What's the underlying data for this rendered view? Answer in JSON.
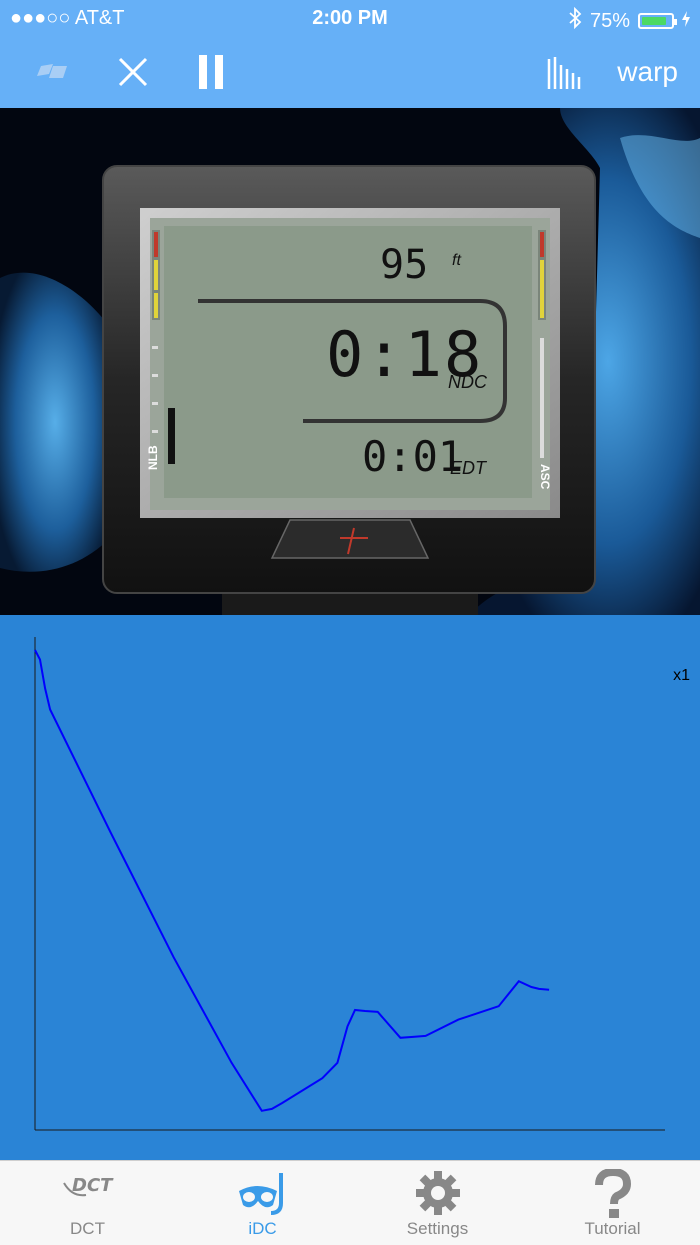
{
  "status_bar": {
    "carrier": "●●●○○ AT&T",
    "time": "2:00 PM",
    "battery": "75%"
  },
  "nav": {
    "warp_label": "warp"
  },
  "dive_computer": {
    "depth": "95",
    "depth_unit": "ft",
    "main_time": "0:18",
    "main_time_label": "NDC",
    "secondary_time": "0:01",
    "secondary_time_label": "EDT",
    "left_gauge_label": "NLB",
    "right_gauge_label": "ASC"
  },
  "graph": {
    "scale_label": "x1"
  },
  "chart_data": {
    "type": "line",
    "series": [
      {
        "values": [
          [
            0,
            0
          ],
          [
            2,
            -10
          ],
          [
            4,
            -40
          ],
          [
            6,
            -62
          ],
          [
            30,
            -190
          ],
          [
            55,
            -320
          ],
          [
            78,
            -430
          ],
          [
            90,
            -480
          ],
          [
            94,
            -478
          ],
          [
            98,
            -472
          ],
          [
            114,
            -446
          ],
          [
            120,
            -430
          ],
          [
            124,
            -392
          ],
          [
            127,
            -375
          ],
          [
            131,
            -376
          ],
          [
            136,
            -377
          ],
          [
            145,
            -404
          ],
          [
            150,
            -403
          ],
          [
            155,
            -402
          ],
          [
            168,
            -385
          ],
          [
            184,
            -371
          ],
          [
            192,
            -345
          ],
          [
            197,
            -351
          ],
          [
            200,
            -353
          ],
          [
            204,
            -354
          ]
        ]
      }
    ],
    "xlim": [
      0,
      250
    ],
    "ylim": [
      -500,
      0
    ],
    "grid": false
  },
  "tabs": [
    {
      "label": "DCT",
      "icon": "dct-logo-icon"
    },
    {
      "label": "iDC",
      "icon": "snorkel-mask-icon"
    },
    {
      "label": "Settings",
      "icon": "gear-icon"
    },
    {
      "label": "Tutorial",
      "icon": "question-icon"
    }
  ],
  "colors": {
    "nav_bg": "#66b0f7",
    "graph_bg": "#2a84d6",
    "graph_line": "#0000ff",
    "lcd_bg": "#8b9a8a",
    "active_tab": "#3a9be8"
  }
}
